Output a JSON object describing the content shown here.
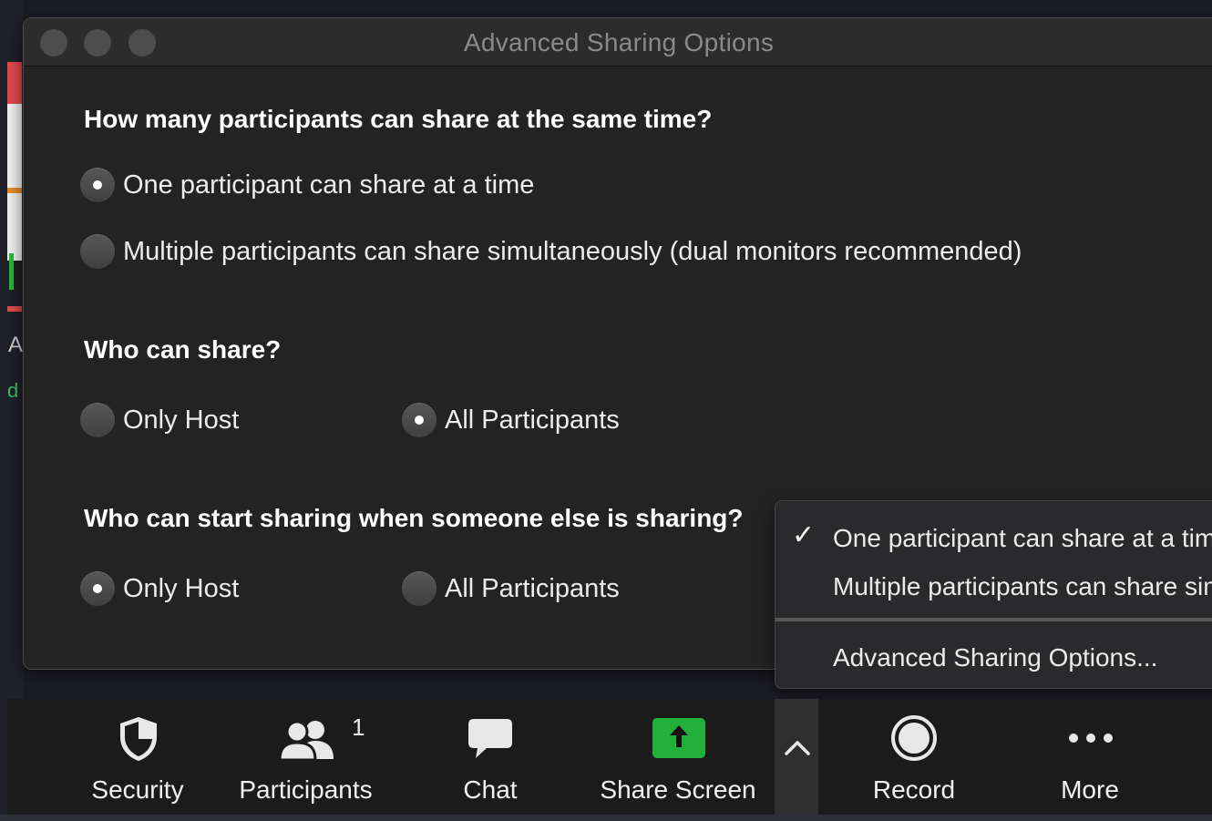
{
  "dialog": {
    "title": "Advanced Sharing Options",
    "q1": {
      "heading": "How many participants can share at the same time?",
      "options": [
        {
          "label": "One participant can share at a time",
          "selected": true
        },
        {
          "label": "Multiple participants can share simultaneously (dual monitors recommended)",
          "selected": false
        }
      ]
    },
    "q2": {
      "heading": "Who can share?",
      "options": [
        {
          "label": "Only Host",
          "selected": false
        },
        {
          "label": "All Participants",
          "selected": true
        }
      ]
    },
    "q3": {
      "heading": "Who can start sharing when someone else is sharing?",
      "options": [
        {
          "label": "Only Host",
          "selected": true
        },
        {
          "label": "All Participants",
          "selected": false
        }
      ]
    }
  },
  "menu": {
    "items": [
      {
        "label": "One participant can share at a time",
        "checked": true
      },
      {
        "label": "Multiple participants can share simultaneously",
        "checked": false
      },
      {
        "label": "Advanced Sharing Options...",
        "checked": false
      }
    ]
  },
  "toolbar": {
    "security": "Security",
    "participants": "Participants",
    "participants_count": "1",
    "chat": "Chat",
    "share_screen": "Share Screen",
    "record": "Record",
    "more": "More"
  },
  "colors": {
    "share_green": "#21b13a",
    "dialog_bg": "#232323"
  }
}
